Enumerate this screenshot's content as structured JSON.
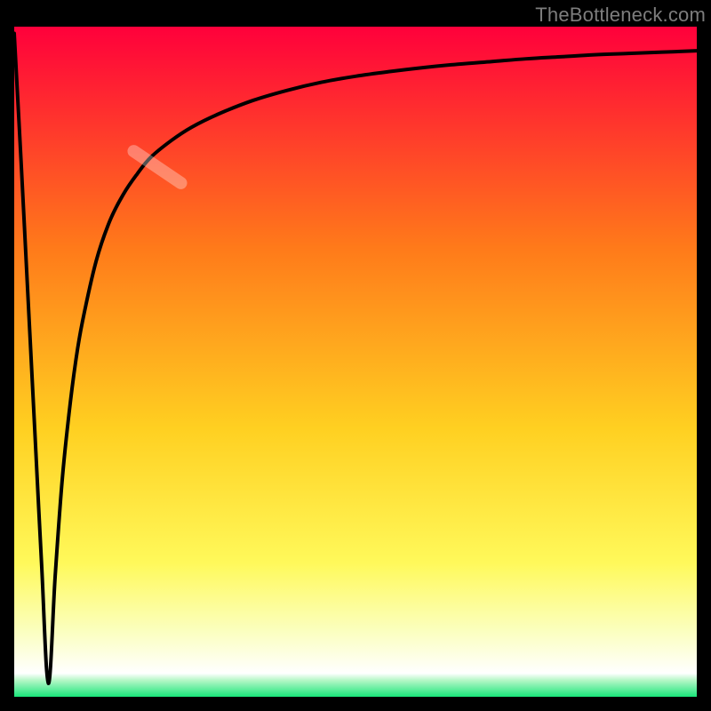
{
  "attribution": "TheBottleneck.com",
  "colors": {
    "top": "#ff003b",
    "upper_mid": "#ff7a1a",
    "mid": "#ffd021",
    "lower_mid": "#fff95a",
    "pale": "#fbffbd",
    "bottom": "#19e67a",
    "background": "#000000",
    "curve": "#000000",
    "highlight": "rgba(255,255,255,0.32)",
    "attribution_text": "#7d7d7d"
  },
  "chart_data": {
    "type": "line",
    "title": "",
    "xlabel": "",
    "ylabel": "",
    "xlim": [
      0,
      100
    ],
    "ylim": [
      0,
      100
    ],
    "series": [
      {
        "name": "bottleneck-curve",
        "comment": "Curve starts near top at x≈0, plunges to ~0 at x≈5 (valley), then rises steeply and asymptotes toward ~97 at the right edge.",
        "x": [
          0,
          1,
          2,
          3,
          4,
          5,
          6,
          7,
          8,
          9,
          10,
          12,
          14,
          16,
          18,
          20,
          23,
          26,
          30,
          35,
          40,
          45,
          50,
          55,
          60,
          65,
          70,
          75,
          80,
          85,
          90,
          95,
          100
        ],
        "values": [
          99,
          80,
          60,
          40,
          20,
          2,
          18,
          32,
          42,
          50,
          56,
          65,
          71,
          75,
          78,
          80.5,
          83,
          85,
          87,
          89,
          90.5,
          91.7,
          92.6,
          93.3,
          93.9,
          94.4,
          94.8,
          95.2,
          95.5,
          95.8,
          96.0,
          96.2,
          96.4
        ]
      }
    ],
    "highlight_segment": {
      "comment": "Semi-transparent rounded segment on rising limb",
      "x_center": 21,
      "y_center": 79,
      "angle_deg": -56
    },
    "gradient_stops": [
      {
        "pos": 0.0,
        "color": "#ff003b"
      },
      {
        "pos": 0.33,
        "color": "#ff7a1a"
      },
      {
        "pos": 0.6,
        "color": "#ffd021"
      },
      {
        "pos": 0.8,
        "color": "#fff95a"
      },
      {
        "pos": 0.9,
        "color": "#fbffbd"
      },
      {
        "pos": 0.965,
        "color": "#ffffff"
      },
      {
        "pos": 0.975,
        "color": "#b7f7c8"
      },
      {
        "pos": 1.0,
        "color": "#19e67a"
      }
    ]
  }
}
